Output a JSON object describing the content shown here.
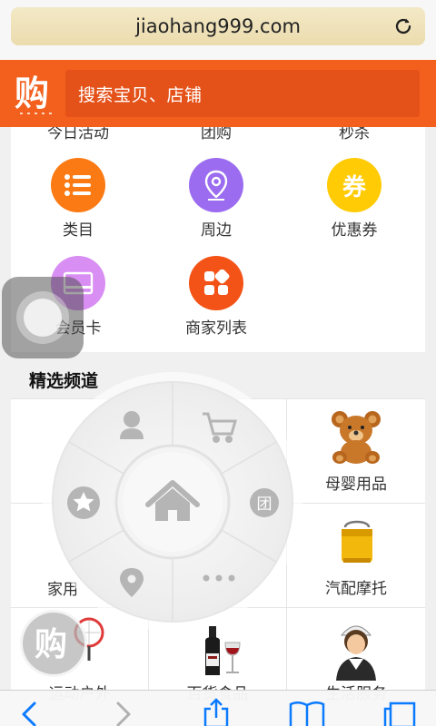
{
  "browser": {
    "url": "jiaohang999.com"
  },
  "header": {
    "search_placeholder": "搜索宝贝、店铺"
  },
  "categories_cut": [
    "今日活动",
    "团购",
    "秒杀"
  ],
  "categories": [
    {
      "label": "类目",
      "icon": "list-icon",
      "color": "#fb7a13"
    },
    {
      "label": "周边",
      "icon": "location-pin-icon",
      "color": "#9b6cef"
    },
    {
      "label": "优惠券",
      "icon": "coupon-icon",
      "glyph": "券",
      "color": "#ffcb05"
    },
    {
      "label": "会员卡",
      "icon": "member-card-icon",
      "color": "#d88ef2"
    },
    {
      "label": "商家列表",
      "icon": "shop-list-icon",
      "color": "#f35316"
    }
  ],
  "section": {
    "title": "精选频道"
  },
  "channels": [
    {
      "label": "母婴用品",
      "icon": "teddy-bear-icon"
    },
    {
      "label": "家用",
      "icon": "home-goods-icon"
    },
    {
      "label": "汽配摩托",
      "icon": "car-battery-icon"
    },
    {
      "label": "运动户外",
      "icon": "badminton-icon"
    },
    {
      "label": "百货食品",
      "icon": "wine-icon"
    },
    {
      "label": "生活服务",
      "icon": "service-person-icon"
    }
  ],
  "radial_menu": {
    "items": [
      "user-icon",
      "cart-icon",
      "group-buy-icon",
      "more-icon",
      "location-icon",
      "favorite-icon"
    ],
    "center": "home-icon",
    "group_glyph": "团"
  },
  "colors": {
    "brand": "#f35f1d",
    "search_bg": "#e4521a",
    "url_bar": "#f3e9c6"
  }
}
